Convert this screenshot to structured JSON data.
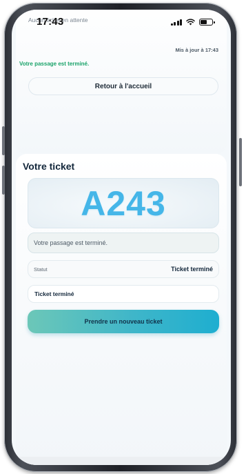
{
  "status_bar": {
    "time": "17:43",
    "signal_bars": 4,
    "battery_level": 0.6
  },
  "top_card": {
    "previous_label": "Aucun ticket en attente",
    "updated_text": "Mis à jour à 17:43",
    "done_message": "Votre passage est terminé.",
    "home_button": "Retour à l'accueil"
  },
  "ticket": {
    "title": "Votre ticket",
    "number": "A243",
    "message": "Votre passage est terminé.",
    "status_label": "Statut",
    "status_value": "Ticket terminé",
    "status_chip": "Ticket terminé",
    "new_ticket_button": "Prendre un nouveau ticket"
  },
  "colors": {
    "ticket_number": "#45b6e8",
    "done_green": "#1aa36a",
    "button_gradient_start": "#6cc7b8",
    "button_gradient_end": "#1eaed0"
  },
  "icons": [
    "signal-icon",
    "wifi-icon",
    "battery-icon"
  ]
}
